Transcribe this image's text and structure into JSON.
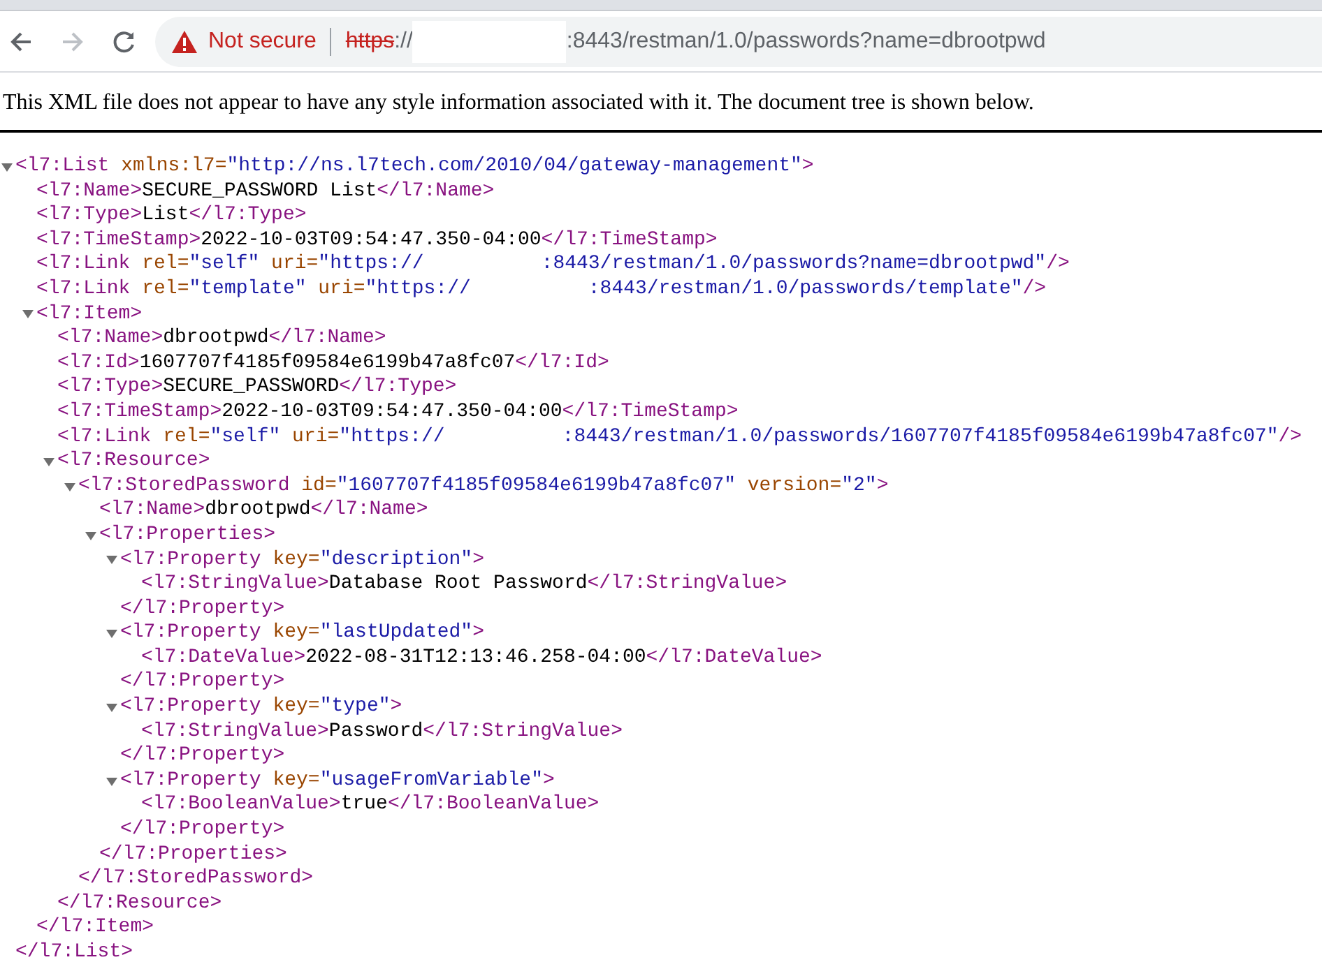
{
  "toolbar": {
    "security_label": "Not secure",
    "url": {
      "scheme": "https",
      "separator": "://",
      "rest": ":8443/restman/1.0/passwords?name=dbrootpwd"
    }
  },
  "notice": "This XML file does not appear to have any style information associated with it. The document tree is shown below.",
  "xml_tree": {
    "expanded": true,
    "open": [
      {
        "kind": "tag",
        "text": "<l7:List"
      },
      {
        "kind": "attr",
        "text": " xmlns:l7="
      },
      {
        "kind": "value",
        "text": "\"http://ns.l7tech.com/2010/04/gateway-management\""
      },
      {
        "kind": "tag",
        "text": ">"
      }
    ],
    "close": [
      {
        "kind": "tag",
        "text": "</l7:List>"
      }
    ],
    "children": [
      {
        "line": [
          {
            "kind": "tag",
            "text": "<l7:Name>"
          },
          {
            "kind": "text",
            "text": "SECURE_PASSWORD List"
          },
          {
            "kind": "tag",
            "text": "</l7:Name>"
          }
        ]
      },
      {
        "line": [
          {
            "kind": "tag",
            "text": "<l7:Type>"
          },
          {
            "kind": "text",
            "text": "List"
          },
          {
            "kind": "tag",
            "text": "</l7:Type>"
          }
        ]
      },
      {
        "line": [
          {
            "kind": "tag",
            "text": "<l7:TimeStamp>"
          },
          {
            "kind": "text",
            "text": "2022-10-03T09:54:47.350-04:00"
          },
          {
            "kind": "tag",
            "text": "</l7:TimeStamp>"
          }
        ]
      },
      {
        "line": [
          {
            "kind": "tag",
            "text": "<l7:Link"
          },
          {
            "kind": "attr",
            "text": " rel="
          },
          {
            "kind": "value",
            "text": "\"self\""
          },
          {
            "kind": "attr",
            "text": " uri="
          },
          {
            "kind": "value",
            "text": "\"https://"
          },
          {
            "kind": "redacted"
          },
          {
            "kind": "value",
            "text": ":8443/restman/1.0/passwords?name=dbrootpwd\""
          },
          {
            "kind": "tag",
            "text": "/>"
          }
        ]
      },
      {
        "line": [
          {
            "kind": "tag",
            "text": "<l7:Link"
          },
          {
            "kind": "attr",
            "text": " rel="
          },
          {
            "kind": "value",
            "text": "\"template\""
          },
          {
            "kind": "attr",
            "text": " uri="
          },
          {
            "kind": "value",
            "text": "\"https://"
          },
          {
            "kind": "redacted"
          },
          {
            "kind": "value",
            "text": ":8443/restman/1.0/passwords/template\""
          },
          {
            "kind": "tag",
            "text": "/>"
          }
        ]
      },
      {
        "expanded": true,
        "open": [
          {
            "kind": "tag",
            "text": "<l7:Item>"
          }
        ],
        "close": [
          {
            "kind": "tag",
            "text": "</l7:Item>"
          }
        ],
        "children": [
          {
            "line": [
              {
                "kind": "tag",
                "text": "<l7:Name>"
              },
              {
                "kind": "text",
                "text": "dbrootpwd"
              },
              {
                "kind": "tag",
                "text": "</l7:Name>"
              }
            ]
          },
          {
            "line": [
              {
                "kind": "tag",
                "text": "<l7:Id>"
              },
              {
                "kind": "text",
                "text": "1607707f4185f09584e6199b47a8fc07"
              },
              {
                "kind": "tag",
                "text": "</l7:Id>"
              }
            ]
          },
          {
            "line": [
              {
                "kind": "tag",
                "text": "<l7:Type>"
              },
              {
                "kind": "text",
                "text": "SECURE_PASSWORD"
              },
              {
                "kind": "tag",
                "text": "</l7:Type>"
              }
            ]
          },
          {
            "line": [
              {
                "kind": "tag",
                "text": "<l7:TimeStamp>"
              },
              {
                "kind": "text",
                "text": "2022-10-03T09:54:47.350-04:00"
              },
              {
                "kind": "tag",
                "text": "</l7:TimeStamp>"
              }
            ]
          },
          {
            "line": [
              {
                "kind": "tag",
                "text": "<l7:Link"
              },
              {
                "kind": "attr",
                "text": " rel="
              },
              {
                "kind": "value",
                "text": "\"self\""
              },
              {
                "kind": "attr",
                "text": " uri="
              },
              {
                "kind": "value",
                "text": "\"https://"
              },
              {
                "kind": "redacted"
              },
              {
                "kind": "value",
                "text": ":8443/restman/1.0/passwords/1607707f4185f09584e6199b47a8fc07\""
              },
              {
                "kind": "tag",
                "text": "/>"
              }
            ]
          },
          {
            "expanded": true,
            "open": [
              {
                "kind": "tag",
                "text": "<l7:Resource>"
              }
            ],
            "close": [
              {
                "kind": "tag",
                "text": "</l7:Resource>"
              }
            ],
            "children": [
              {
                "expanded": true,
                "open": [
                  {
                    "kind": "tag",
                    "text": "<l7:StoredPassword"
                  },
                  {
                    "kind": "attr",
                    "text": " id="
                  },
                  {
                    "kind": "value",
                    "text": "\"1607707f4185f09584e6199b47a8fc07\""
                  },
                  {
                    "kind": "attr",
                    "text": " version="
                  },
                  {
                    "kind": "value",
                    "text": "\"2\""
                  },
                  {
                    "kind": "tag",
                    "text": ">"
                  }
                ],
                "close": [
                  {
                    "kind": "tag",
                    "text": "</l7:StoredPassword>"
                  }
                ],
                "children": [
                  {
                    "line": [
                      {
                        "kind": "tag",
                        "text": "<l7:Name>"
                      },
                      {
                        "kind": "text",
                        "text": "dbrootpwd"
                      },
                      {
                        "kind": "tag",
                        "text": "</l7:Name>"
                      }
                    ]
                  },
                  {
                    "expanded": true,
                    "open": [
                      {
                        "kind": "tag",
                        "text": "<l7:Properties>"
                      }
                    ],
                    "close": [
                      {
                        "kind": "tag",
                        "text": "</l7:Properties>"
                      }
                    ],
                    "children": [
                      {
                        "expanded": true,
                        "open": [
                          {
                            "kind": "tag",
                            "text": "<l7:Property"
                          },
                          {
                            "kind": "attr",
                            "text": " key="
                          },
                          {
                            "kind": "value",
                            "text": "\"description\""
                          },
                          {
                            "kind": "tag",
                            "text": ">"
                          }
                        ],
                        "close": [
                          {
                            "kind": "tag",
                            "text": "</l7:Property>"
                          }
                        ],
                        "children": [
                          {
                            "line": [
                              {
                                "kind": "tag",
                                "text": "<l7:StringValue>"
                              },
                              {
                                "kind": "text",
                                "text": "Database Root Password"
                              },
                              {
                                "kind": "tag",
                                "text": "</l7:StringValue>"
                              }
                            ]
                          }
                        ]
                      },
                      {
                        "expanded": true,
                        "open": [
                          {
                            "kind": "tag",
                            "text": "<l7:Property"
                          },
                          {
                            "kind": "attr",
                            "text": " key="
                          },
                          {
                            "kind": "value",
                            "text": "\"lastUpdated\""
                          },
                          {
                            "kind": "tag",
                            "text": ">"
                          }
                        ],
                        "close": [
                          {
                            "kind": "tag",
                            "text": "</l7:Property>"
                          }
                        ],
                        "children": [
                          {
                            "line": [
                              {
                                "kind": "tag",
                                "text": "<l7:DateValue>"
                              },
                              {
                                "kind": "text",
                                "text": "2022-08-31T12:13:46.258-04:00"
                              },
                              {
                                "kind": "tag",
                                "text": "</l7:DateValue>"
                              }
                            ]
                          }
                        ]
                      },
                      {
                        "expanded": true,
                        "open": [
                          {
                            "kind": "tag",
                            "text": "<l7:Property"
                          },
                          {
                            "kind": "attr",
                            "text": " key="
                          },
                          {
                            "kind": "value",
                            "text": "\"type\""
                          },
                          {
                            "kind": "tag",
                            "text": ">"
                          }
                        ],
                        "close": [
                          {
                            "kind": "tag",
                            "text": "</l7:Property>"
                          }
                        ],
                        "children": [
                          {
                            "line": [
                              {
                                "kind": "tag",
                                "text": "<l7:StringValue>"
                              },
                              {
                                "kind": "text",
                                "text": "Password"
                              },
                              {
                                "kind": "tag",
                                "text": "</l7:StringValue>"
                              }
                            ]
                          }
                        ]
                      },
                      {
                        "expanded": true,
                        "open": [
                          {
                            "kind": "tag",
                            "text": "<l7:Property"
                          },
                          {
                            "kind": "attr",
                            "text": " key="
                          },
                          {
                            "kind": "value",
                            "text": "\"usageFromVariable\""
                          },
                          {
                            "kind": "tag",
                            "text": ">"
                          }
                        ],
                        "close": [
                          {
                            "kind": "tag",
                            "text": "</l7:Property>"
                          }
                        ],
                        "children": [
                          {
                            "line": [
                              {
                                "kind": "tag",
                                "text": "<l7:BooleanValue>"
                              },
                              {
                                "kind": "text",
                                "text": "true"
                              },
                              {
                                "kind": "tag",
                                "text": "</l7:BooleanValue>"
                              }
                            ]
                          }
                        ]
                      }
                    ]
                  }
                ]
              }
            ]
          }
        ]
      }
    ]
  }
}
